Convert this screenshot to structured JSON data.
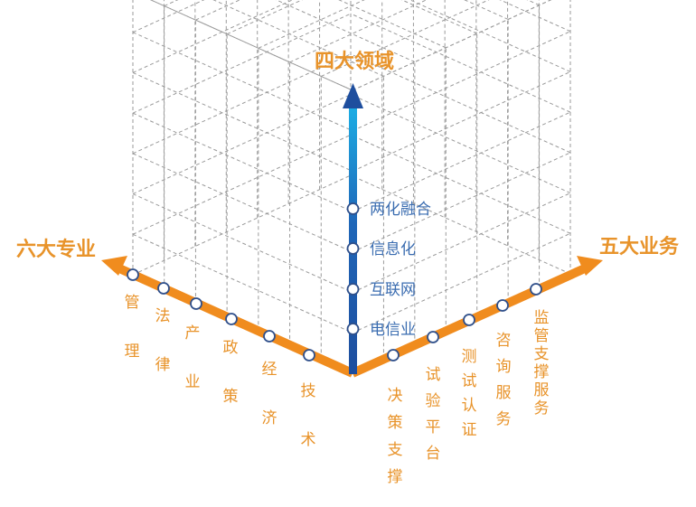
{
  "titles": {
    "top": "四大领域",
    "left": "六大专业",
    "right": "五大业务"
  },
  "vertical_axis": {
    "labels": [
      "电信业",
      "互联网",
      "信息化",
      "两化融合"
    ]
  },
  "left_axis": {
    "labels": [
      "管理",
      "法律",
      "产业",
      "政策",
      "经济",
      "技术"
    ]
  },
  "right_axis": {
    "labels": [
      "决策支撑",
      "试验平台",
      "测试认证",
      "咨询服务",
      "监管支撑服务"
    ]
  },
  "colors": {
    "orange": "#F08C1E",
    "label_orange": "#E8932A",
    "blue_dark": "#1F4F9F",
    "blue_light": "#1BA8E0",
    "grid": "#9A9A9A",
    "vertical_label": "#3A6CB0"
  }
}
